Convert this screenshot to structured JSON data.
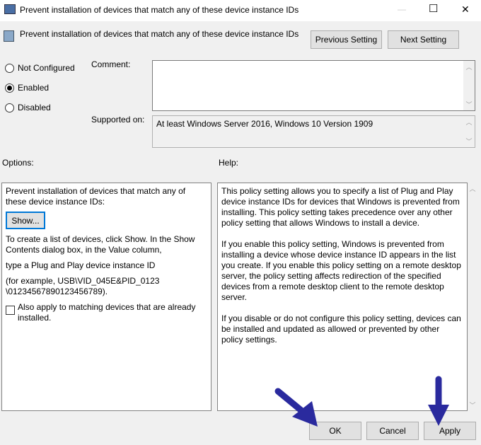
{
  "window": {
    "title": "Prevent installation of devices that match any of these device instance IDs",
    "minimize": "—",
    "maximize": "☐",
    "close": "✕"
  },
  "header": {
    "policy_title": "Prevent installation of devices that match any of these device instance IDs",
    "previous_label": "Previous Setting",
    "next_label": "Next Setting"
  },
  "state": {
    "options": [
      {
        "label": "Not Configured",
        "selected": false
      },
      {
        "label": "Enabled",
        "selected": true
      },
      {
        "label": "Disabled",
        "selected": false
      }
    ]
  },
  "comment": {
    "label": "Comment:",
    "value": ""
  },
  "supported": {
    "label": "Supported on:",
    "value": "At least Windows Server 2016, Windows 10 Version 1909"
  },
  "options_panel": {
    "label": "Options:",
    "intro": "Prevent installation of devices that match any of these device instance IDs:",
    "show_label": "Show...",
    "p1": "To create a list of devices, click Show. In the Show Contents dialog box, in the Value column,",
    "p2": "type a Plug and Play device instance ID",
    "p3": "(for example, USB\\VID_045E&PID_0123 \\01234567890123456789).",
    "checkbox_label": "Also apply to matching devices that are already installed.",
    "checkbox_checked": false
  },
  "help_panel": {
    "label": "Help:",
    "p1": "This policy setting allows you to specify a list of Plug and Play device instance IDs for devices that Windows is prevented from installing. This policy setting takes precedence over any other policy setting that allows Windows to install a device.",
    "p2": "If you enable this policy setting, Windows is prevented from installing a device whose device instance ID appears in the list you create. If you enable this policy setting on a remote desktop server, the policy setting affects redirection of the specified devices from a remote desktop client to the remote desktop server.",
    "p3": "If you disable or do not configure this policy setting, devices can be installed and updated as allowed or prevented by other policy settings."
  },
  "footer": {
    "ok": "OK",
    "cancel": "Cancel",
    "apply": "Apply"
  },
  "colors": {
    "arrow": "#2a2a9e"
  }
}
